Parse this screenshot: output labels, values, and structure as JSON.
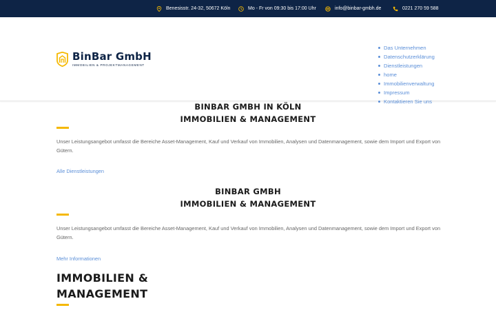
{
  "topbar": {
    "address": "Benesisstr. 24-32, 50672 Köln",
    "hours": "Mo - Fr von 09:30 bis 17:00 Uhr",
    "email": "info@binbar-gmbh.de",
    "phone": "0221 270 59 588",
    "icons": [
      "map-pin-icon",
      "clock-icon",
      "mail-icon",
      "phone-icon"
    ],
    "background": "#0e2446",
    "icon_color": "#f5b800"
  },
  "logo": {
    "name": "BinBar GmbH",
    "subtitle": "IMMOBILIEN & PROJEKTMANAGEMENT"
  },
  "nav": {
    "items": [
      "Das Unternehmen",
      "Datenschutzerklärung",
      "Dienstleistungen",
      "home",
      "Immobilienverwaltung",
      "Impressum",
      "Kontaktieren Sie uns"
    ],
    "link_color": "#5b8fd8"
  },
  "sections": [
    {
      "title_line1": "BINBAR GMBH IN KÖLN",
      "title_line2": "IMMOBILIEN & MANAGEMENT",
      "text": "Unser Leistungsangebot umfasst die Bereiche Asset-Management, Kauf und Verkauf von Immobilien, Analysen und Datenmanagement, sowie dem Import und Export von Gütern.",
      "link": "Alle Dienstleistungen"
    },
    {
      "title_line1": "BINBAR GMBH",
      "title_line2": "IMMOBILIEN & MANAGEMENT",
      "text": "Unser Leistungsangebot umfasst die Bereiche Asset-Management, Kauf und Verkauf von Immobilien, Analysen und Datenmanagement, sowie dem Import und Export von Gütern.",
      "link": "Mehr Informationen"
    }
  ],
  "third_heading": {
    "line1": "IMMOBILIEN &",
    "line2": "MANAGEMENT"
  },
  "accent_color": "#f5b800"
}
